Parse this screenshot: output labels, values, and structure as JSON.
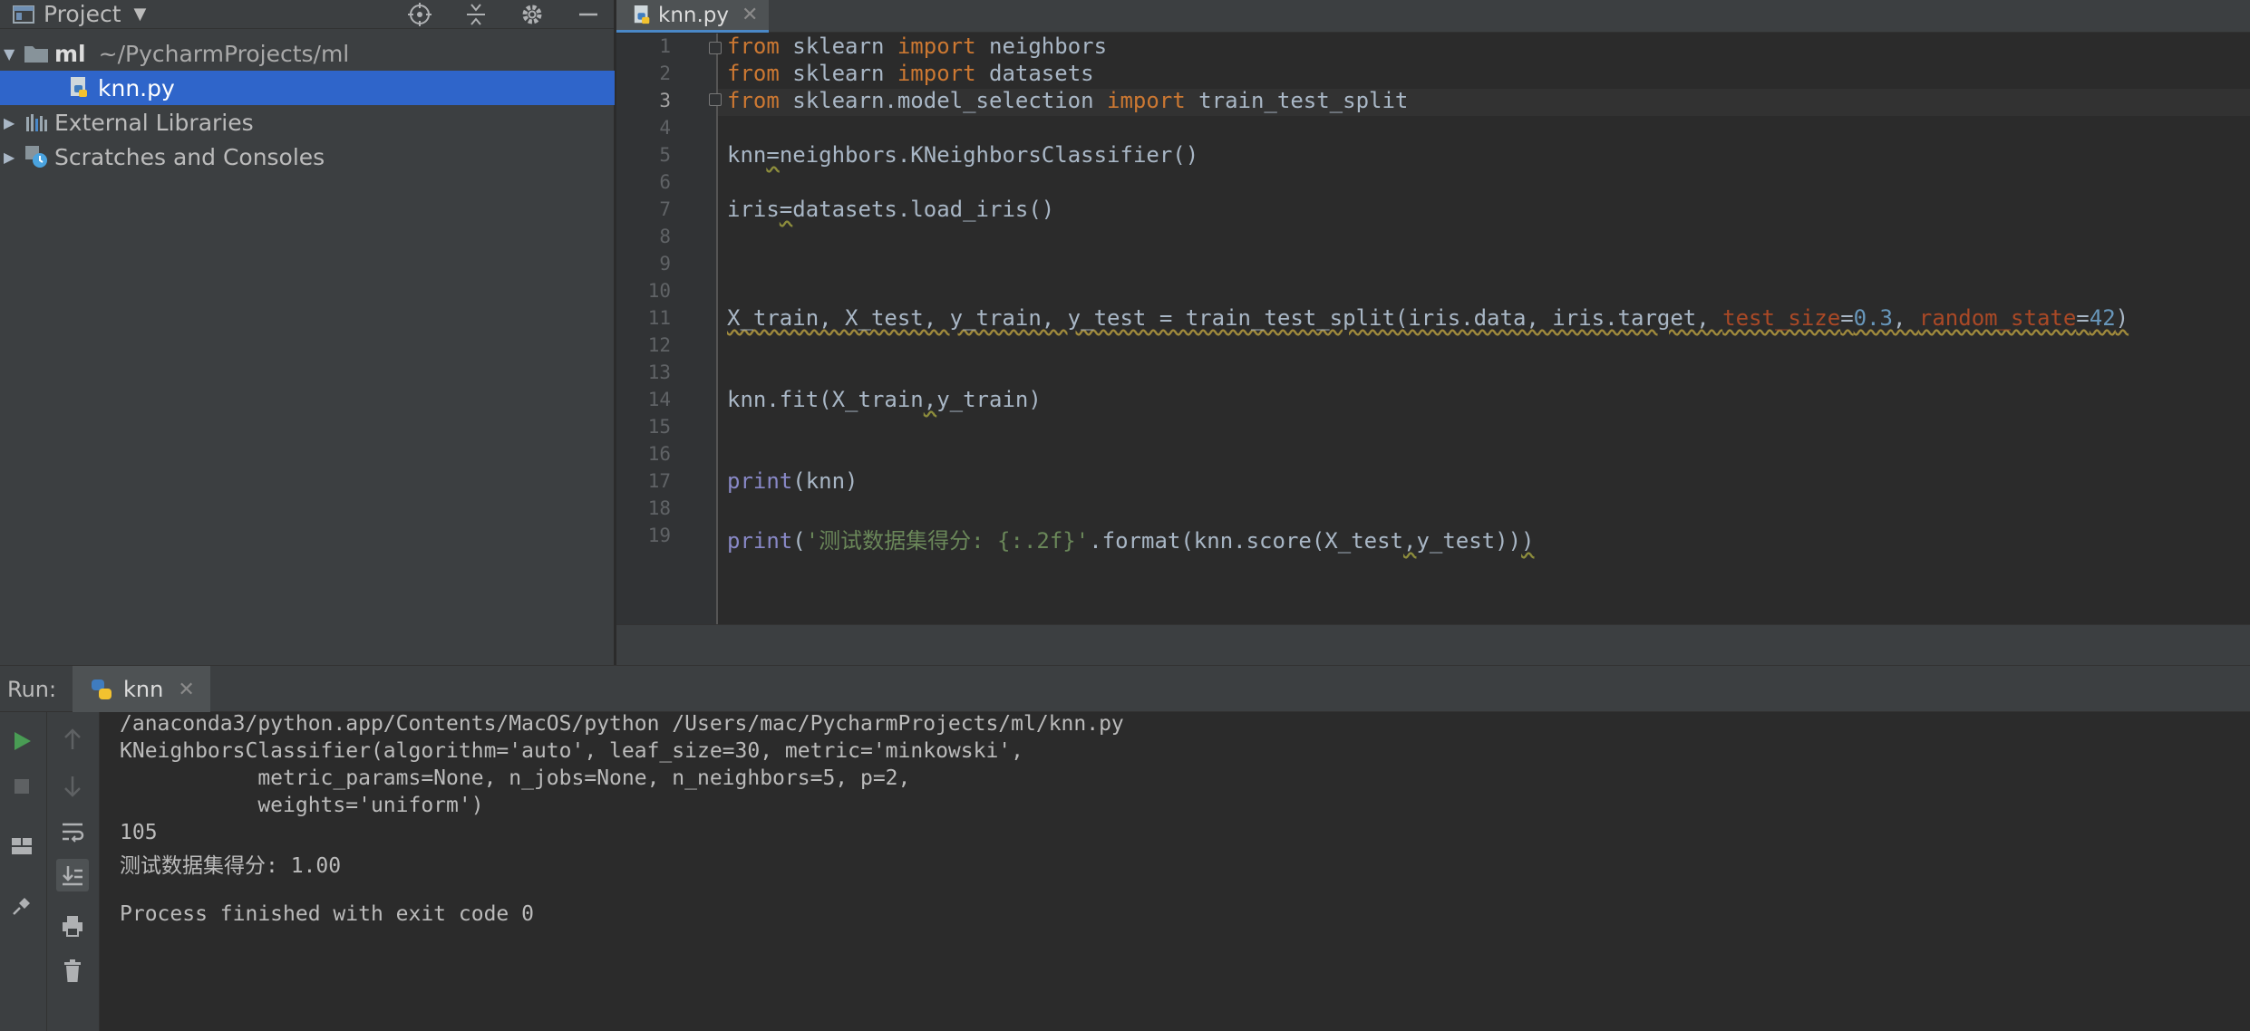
{
  "project_panel": {
    "title": "Project",
    "tree": [
      {
        "name": "ml",
        "path": "~/PycharmProjects/ml"
      },
      {
        "name": "knn.py"
      },
      {
        "name": "External Libraries"
      },
      {
        "name": "Scratches and Consoles"
      }
    ]
  },
  "editor": {
    "tab_label": "knn.py",
    "line_numbers": [
      "1",
      "2",
      "3",
      "4",
      "5",
      "6",
      "7",
      "8",
      "9",
      "10",
      "11",
      "12",
      "13",
      "14",
      "15",
      "16",
      "17",
      "18",
      "19"
    ],
    "current_line": 3,
    "code": {
      "l1": {
        "kw1": "from",
        "mod": " sklearn ",
        "kw2": "import",
        "rest": " neighbors"
      },
      "l2": {
        "kw1": "from",
        "mod": " sklearn ",
        "kw2": "import",
        "rest": " datasets"
      },
      "l3": {
        "kw1": "from",
        "mod": " sklearn.model_selection ",
        "kw2": "import",
        "rest": " train_test_split"
      },
      "l5": {
        "a": "knn",
        "b": "=",
        "c": "neighbors.KNeighborsClassifier()"
      },
      "l7": {
        "a": "iris",
        "b": "=",
        "c": "datasets.load_iris()"
      },
      "l11": {
        "a": "X_train, X_test, y_train, y_test = train_test_split(iris.data, iris.target, ",
        "p1": "test_size",
        "eq1": "=",
        "n1": "0.3",
        "sep": ", ",
        "p2": "random_state",
        "eq2": "=",
        "n2": "42",
        "close": ")"
      },
      "l14": {
        "a": "knn.fit(X_train",
        "b": ",",
        "c": "y_train)"
      },
      "l17": {
        "fn": "print",
        "rest": "(knn)"
      },
      "l19": {
        "fn": "print",
        "open": "(",
        "str": "'测试数据集得分: {:.2f}'",
        "mid": ".format(knn.score(X_test",
        "comma": ",",
        "end": "y_test))",
        "last": ")"
      }
    }
  },
  "run_panel": {
    "label": "Run:",
    "tab_label": "knn",
    "output": [
      "/anaconda3/python.app/Contents/MacOS/python /Users/mac/PycharmProjects/ml/knn.py",
      "KNeighborsClassifier(algorithm='auto', leaf_size=30, metric='minkowski',",
      "           metric_params=None, n_jobs=None, n_neighbors=5, p=2,",
      "           weights='uniform')",
      "105",
      "测试数据集得分: 1.00",
      "",
      "Process finished with exit code 0"
    ]
  },
  "icons": {
    "project": "project-window-icon",
    "folder": "folder-icon",
    "python_file": "python-file-icon",
    "libraries": "libraries-icon",
    "scratches": "scratches-icon",
    "run": "run-icon",
    "stop": "stop-icon"
  },
  "colors": {
    "selection": "#2f65ca",
    "keyword": "#cc7832",
    "builtin": "#8888c6",
    "number": "#6897bb",
    "string": "#6a8759",
    "param": "#aa4926",
    "run_green": "#499c54"
  }
}
